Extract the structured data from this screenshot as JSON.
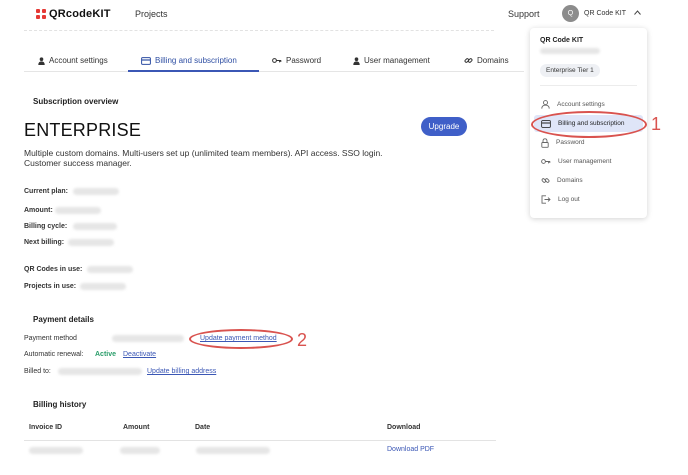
{
  "topbar": {
    "logo_text": "QRcodeKIT",
    "projects": "Projects",
    "support": "Support",
    "avatar_initial": "Q",
    "user_name": "QR Code KIT"
  },
  "tabs": [
    {
      "label": "Account settings",
      "icon": "user-icon"
    },
    {
      "label": "Billing and subscription",
      "icon": "credit-card-icon",
      "active": true
    },
    {
      "label": "Password",
      "icon": "key-icon"
    },
    {
      "label": "User management",
      "icon": "user-icon"
    },
    {
      "label": "Domains",
      "icon": "link-icon"
    }
  ],
  "subscription": {
    "section_title": "Subscription overview",
    "plan_name": "ENTERPRISE",
    "description": "Multiple custom domains. Multi-users set up (unlimited team members). API access. SSO login. Customer success manager.",
    "upgrade_label": "Upgrade",
    "fields": [
      "Current plan:",
      "Amount:",
      "Billing cycle:",
      "Next billing:"
    ],
    "usage_fields": [
      "QR Codes in use:",
      "Projects in use:"
    ]
  },
  "payment": {
    "section_title": "Payment details",
    "method_label": "Payment method",
    "update_method_link": "Update payment method",
    "renewal_label": "Automatic renewal:",
    "renewal_status": "Active",
    "deactivate_link": "Deactivate",
    "billed_label": "Billed to:",
    "update_address_link": "Update billing address"
  },
  "billing_history": {
    "section_title": "Billing history",
    "columns": [
      "Invoice ID",
      "Amount",
      "Date",
      "Download"
    ],
    "row_download": "Download PDF"
  },
  "dropdown": {
    "account_name": "QR Code KIT",
    "tier": "Enterprise Tier 1",
    "items": [
      {
        "label": "Account settings",
        "icon": "user-icon"
      },
      {
        "label": "Billing and subscription",
        "icon": "credit-card-icon",
        "selected": true
      },
      {
        "label": "Password",
        "icon": "lock-icon"
      },
      {
        "label": "User management",
        "icon": "key-icon"
      },
      {
        "label": "Domains",
        "icon": "link-icon"
      },
      {
        "label": "Log out",
        "icon": "logout-icon"
      }
    ]
  },
  "annotations": [
    "1",
    "2"
  ],
  "colors": {
    "accent": "#3b57b5",
    "annotation": "#d9534f",
    "active_green": "#2a9d6a",
    "logo_red": "#e53935"
  }
}
